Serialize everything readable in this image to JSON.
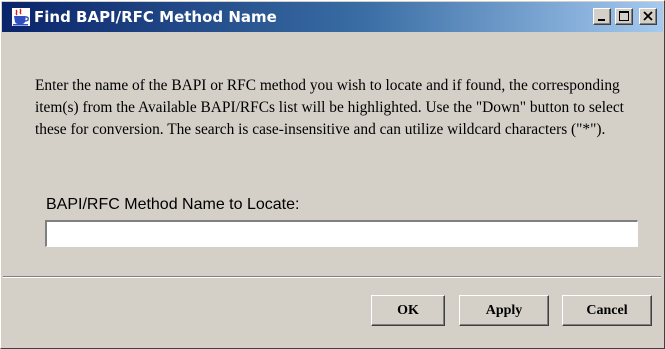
{
  "window": {
    "title": "Find BAPI/RFC Method Name",
    "app_icon": "java-coffee-cup-icon",
    "controls": {
      "minimize_icon": "minimize-icon",
      "maximize_icon": "maximize-icon",
      "close_icon": "close-icon"
    }
  },
  "dialog": {
    "instructions": "Enter the name of the BAPI or RFC method you wish to locate and if found, the corresponding item(s) from the Available BAPI/RFCs list will be highlighted.  Use the \"Down\" button to select these for conversion.  The search is case-insensitive and can utilize wildcard characters (\"*\").",
    "field_label": "BAPI/RFC Method Name to Locate:",
    "field_value": ""
  },
  "buttons": {
    "ok": "OK",
    "apply": "Apply",
    "cancel": "Cancel"
  },
  "colors": {
    "titlebar_start": "#0a246a",
    "titlebar_end": "#a6caf0",
    "face": "#d4d0c8"
  }
}
